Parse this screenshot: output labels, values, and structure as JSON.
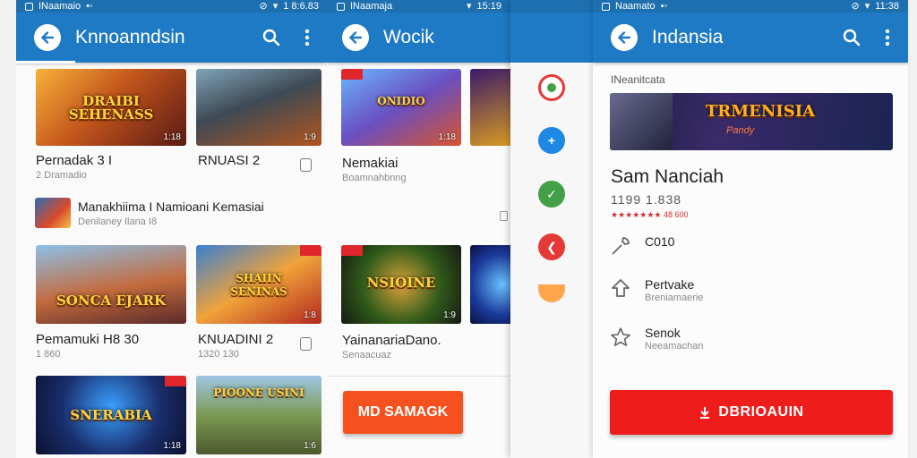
{
  "panel1": {
    "status": {
      "carrier": "INaamaio",
      "time": "1 8:6.83"
    },
    "title": "Knnoanndsin",
    "items": [
      {
        "title": "Pernadak 3 I",
        "sub": "2 Dramadio",
        "thumb": "DRAIBI SEHENASS",
        "dur": "1:18"
      },
      {
        "title": "RNUASI 2",
        "sub": "",
        "thumb": "",
        "dur": "1:9"
      },
      {
        "title": "Pemamuki H8 30",
        "sub": "1 860",
        "thumb": "SONCA EJARK",
        "dur": ""
      },
      {
        "title": "KNUADINI 2",
        "sub": "1320 130",
        "thumb": "SHAIIN SENINAS",
        "dur": "1:8"
      },
      {
        "title": "",
        "sub": "",
        "thumb": "SNERABIA",
        "dur": "1:18"
      },
      {
        "title": "",
        "sub": "",
        "thumb": "PIOONE USINI",
        "dur": "1:6"
      }
    ],
    "wide_item": {
      "title": "Manakhiima I Namioani Kemasiai",
      "sub": "Denilaney Ilana I8"
    }
  },
  "panel2": {
    "status": {
      "carrier": "INaamaja",
      "time": "15:19"
    },
    "title": "Wocik",
    "items": [
      {
        "title": "Nemakiai",
        "sub": "Boamnahbnng",
        "thumb": "ONIDIO",
        "dur": "1:18"
      },
      {
        "title": "YainanariaDano.",
        "sub": "Senaacuaz",
        "thumb": "NSIOINE",
        "dur": "1:9"
      }
    ],
    "button": "MD SAMAGK"
  },
  "panel3": {
    "status": {
      "carrier": "Naamato",
      "time": "11:38"
    },
    "title": "Indansia",
    "section": "INeanitcata",
    "banner": "TRMENISIA",
    "banner_sub": "Pandy",
    "app_name": "Sam Nanciah",
    "meta": "1199 1.838",
    "rating": "★★★★★★★ 48 600",
    "rows": [
      {
        "title": "C010",
        "sub": ""
      },
      {
        "title": "Pertvake",
        "sub": "Breniamaerie"
      },
      {
        "title": "Senok",
        "sub": "Neeamachan"
      }
    ],
    "button": "DBRIOAUIN"
  }
}
